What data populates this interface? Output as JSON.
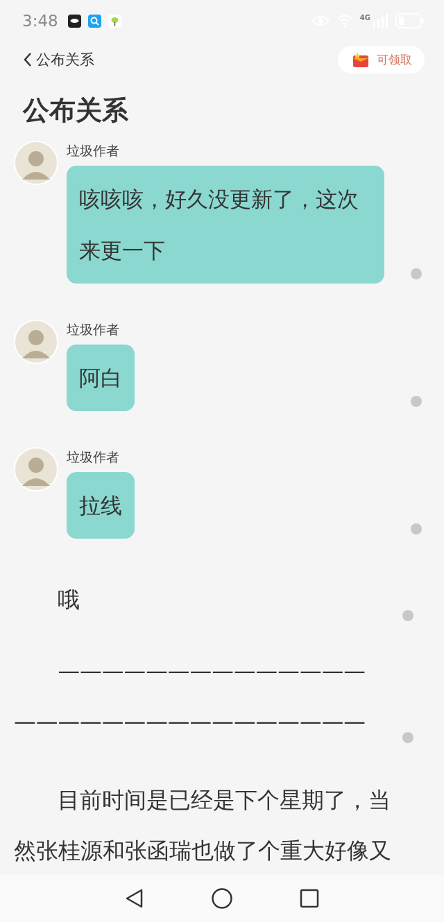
{
  "status_bar": {
    "time": "3:48",
    "network": "4G"
  },
  "header": {
    "back_label": "公布关系",
    "reward_button": "可领取"
  },
  "title": "公布关系",
  "posts": [
    {
      "kind": "message",
      "author": "垃圾作者",
      "text": "咳咳咳，好久没更新了，这次来更一下"
    },
    {
      "kind": "message",
      "author": "垃圾作者",
      "text": "阿白"
    },
    {
      "kind": "message",
      "author": "垃圾作者",
      "text": "拉线"
    },
    {
      "kind": "paragraph",
      "lines": [
        "哦"
      ]
    },
    {
      "kind": "paragraph",
      "lines": [
        "——————————————",
        "————————————————"
      ]
    },
    {
      "kind": "paragraph",
      "lines": [
        "目前时间是已经是下个星期了，当然张桂源和张函瑞也做了个重大好像又"
      ]
    }
  ]
}
